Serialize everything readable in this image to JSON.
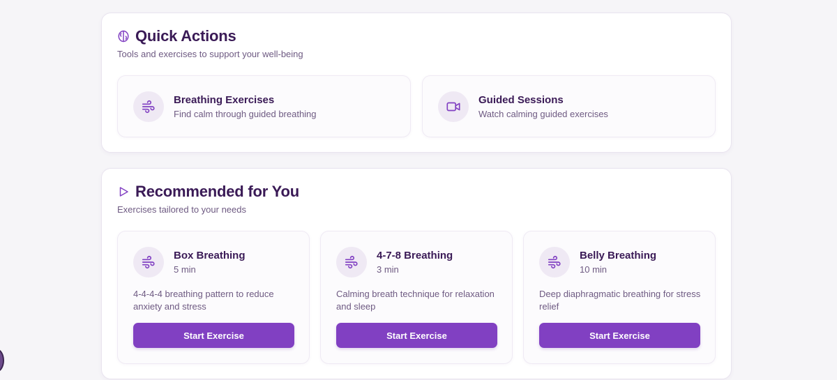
{
  "quick_actions": {
    "title": "Quick Actions",
    "subtitle": "Tools and exercises to support your well-being",
    "icon": "brain-icon",
    "items": [
      {
        "title": "Breathing Exercises",
        "description": "Find calm through guided breathing",
        "icon": "wind-icon"
      },
      {
        "title": "Guided Sessions",
        "description": "Watch calming guided exercises",
        "icon": "video-camera-icon"
      }
    ]
  },
  "recommended": {
    "title": "Recommended for You",
    "subtitle": "Exercises tailored to your needs",
    "icon": "play-icon",
    "items": [
      {
        "title": "Box Breathing",
        "duration": "5 min",
        "description": "4-4-4-4 breathing pattern to reduce anxiety and stress",
        "button": "Start Exercise",
        "icon": "wind-icon"
      },
      {
        "title": "4-7-8 Breathing",
        "duration": "3 min",
        "description": "Calming breath technique for relaxation and sleep",
        "button": "Start Exercise",
        "icon": "wind-icon"
      },
      {
        "title": "Belly Breathing",
        "duration": "10 min",
        "description": "Deep diaphragmatic breathing for stress relief",
        "button": "Start Exercise",
        "icon": "wind-icon"
      }
    ]
  },
  "colors": {
    "accent": "#8140c2",
    "heading": "#3a1a56",
    "muted": "#6e5a82",
    "icon_bg": "#efe9f4"
  }
}
